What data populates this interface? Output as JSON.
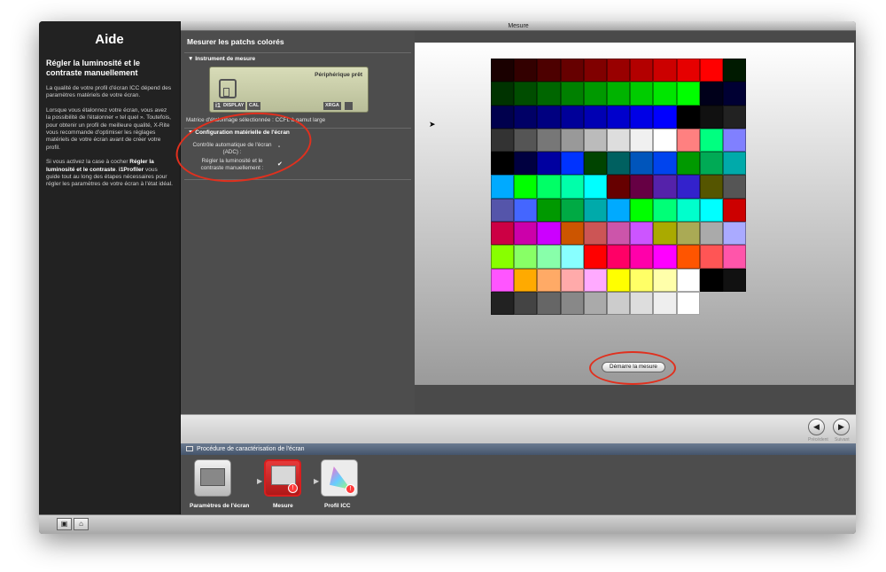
{
  "help": {
    "title": "Aide",
    "heading": "Régler la luminosité et le contraste manuellement",
    "p1": "La qualité de votre profil d'écran ICC dépend des paramètres matériels de votre écran.",
    "p2": "Lorsque vous étalonnez votre écran, vous avez la possibilité de l'étalonner « tel quel ». Toutefois, pour obtenir un profil de meilleure qualité, X-Rite vous recommande d'optimiser les réglages matériels de votre écran avant de créer votre profil.",
    "p3_pre": "Si vous activez la case à cocher ",
    "p3_bold": "Régler la luminosité et le contraste",
    "p3_app": "i1Profiler",
    "p3_post": " vous guide tout au long des étapes nécessaires pour régler les paramètres de votre écran à l'état idéal."
  },
  "window_title": "Mesure",
  "settings": {
    "title": "Mesurer les patchs colorés",
    "instrument_header": "Instrument de mesure",
    "device_status": "Périphérique prêt",
    "device_tag_i1": "i1",
    "device_tag_display": "DISPLAY",
    "device_tag_cal": "CAL",
    "device_tag_xrga": "XRGA",
    "device_mode": "Matrice d'étalonnage sélectionnée : CCFL à gamut large",
    "hardware_header": "Configuration matérielle de l'écran",
    "adc_label_1": "Contrôle automatique de l'écran",
    "adc_label_2": "(ADC) :",
    "manual_label_1": "Régler la luminosité et le",
    "manual_label_2": "contraste manuellement :",
    "manual_checked": "✔"
  },
  "patches": {
    "colors": [
      "#1a0000",
      "#330000",
      "#4d0000",
      "#660000",
      "#800000",
      "#990000",
      "#b30000",
      "#cc0000",
      "#e60000",
      "#ff0000",
      "#001a00",
      "#003300",
      "#004d00",
      "#006600",
      "#008000",
      "#009900",
      "#00b300",
      "#00cc00",
      "#00e600",
      "#00ff00",
      "#00001a",
      "#000033",
      "#00004d",
      "#000066",
      "#000080",
      "#000099",
      "#0000b3",
      "#0000cc",
      "#0000e6",
      "#0000ff",
      "#000000",
      "#111111",
      "#222222",
      "#333333",
      "#555555",
      "#777777",
      "#999999",
      "#bbbbbb",
      "#dddddd",
      "#f0f0f0",
      "#ffffff",
      "#ff8080",
      "#00ff80",
      "#8080ff",
      "#000000",
      "#000040",
      "#0000a0",
      "#0033ff",
      "#004400",
      "#006060",
      "#0055bb",
      "#0044ee",
      "#009900",
      "#00aa55",
      "#00aaaa",
      "#00aaff",
      "#00ff00",
      "#00ff66",
      "#00ffaa",
      "#00ffff",
      "#660000",
      "#660044",
      "#5522aa",
      "#3322cc",
      "#555500",
      "#555555",
      "#5555aa",
      "#4466ff",
      "#009900",
      "#00aa44",
      "#00aaaa",
      "#00aaff",
      "#00ff00",
      "#00ff77",
      "#00ffcc",
      "#00ffff",
      "#cc0000",
      "#cc0044",
      "#cc00aa",
      "#cc00ff",
      "#cc5500",
      "#cc5555",
      "#cc55aa",
      "#cc55ff",
      "#aaaa00",
      "#aaaa55",
      "#aaaaaa",
      "#aaaaff",
      "#88ff00",
      "#88ff66",
      "#88ffaa",
      "#88ffff",
      "#ff0000",
      "#ff0066",
      "#ff00aa",
      "#ff00ff",
      "#ff5500",
      "#ff5555",
      "#ff55aa",
      "#ff55ff",
      "#ffaa00",
      "#ffaa66",
      "#ffaaaa",
      "#ffaaff",
      "#ffff00",
      "#ffff66",
      "#ffffaa",
      "#ffffff",
      "#000000",
      "#111111",
      "#222222",
      "#444444",
      "#666666",
      "#888888",
      "#aaaaaa",
      "#cccccc",
      "#dddddd",
      "#eeeeee",
      "#ffffff"
    ]
  },
  "start_button": "Démarre la mesure",
  "nav": {
    "prev_label": "Précédent",
    "next_label": "Suivant"
  },
  "workflow": {
    "header": "Procédure de caractérisation de l'écran",
    "steps": [
      {
        "label": "Paramètres de l'écran"
      },
      {
        "label": "Mesure"
      },
      {
        "label": "Profil ICC"
      }
    ]
  },
  "colors": {
    "accent_red": "#e0301e",
    "active_step": "#d81e1e"
  }
}
